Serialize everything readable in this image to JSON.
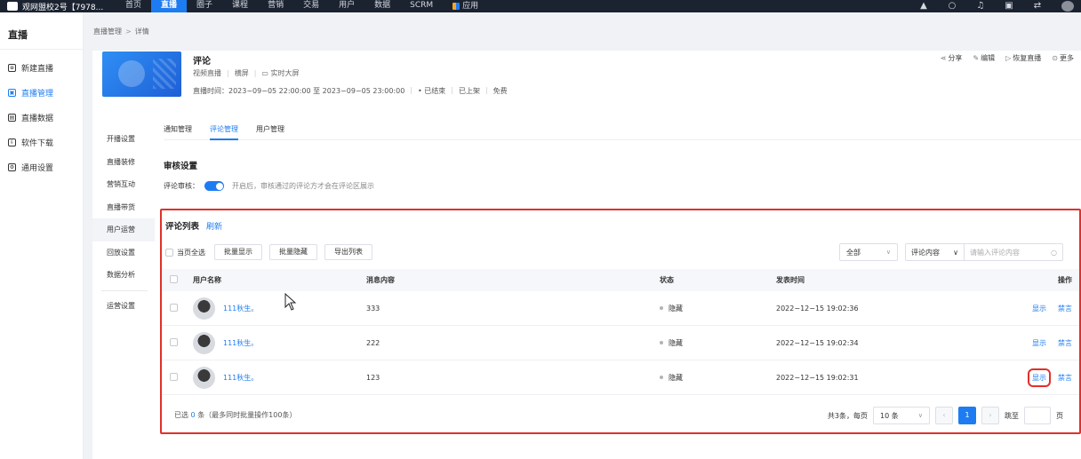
{
  "topnav": {
    "brand": "观网盟校2号【7978...",
    "items": [
      "首页",
      "直播",
      "圈子",
      "课程",
      "营销",
      "交易",
      "用户",
      "数据",
      "SCRM",
      "应用"
    ],
    "active_index": 1,
    "accent_color": "#1e7cf2",
    "icons": [
      "logo-icon",
      "search-icon",
      "bell-icon",
      "layout-icon",
      "swap-icon",
      "avatar"
    ]
  },
  "sidebar": {
    "title": "直播",
    "items": [
      {
        "label": "新建直播",
        "icon": "new-live-icon"
      },
      {
        "label": "直播管理",
        "icon": "live-manage-icon",
        "active": true
      },
      {
        "label": "直播数据",
        "icon": "live-data-icon"
      },
      {
        "label": "软件下载",
        "icon": "download-icon"
      },
      {
        "label": "通用设置",
        "icon": "settings-icon"
      }
    ]
  },
  "breadcrumb": {
    "parent": "直播管理",
    "sep": ">",
    "current": "详情"
  },
  "live_info": {
    "title": "评论",
    "type": "视频直播",
    "orientation": "横屏",
    "screen": "实时大屏",
    "time_label": "直播时间：2023−09−05 22:00:00 至 2023−09−05 23:00:00",
    "status": "• 已结束",
    "shelf": "已上架",
    "price": "免费",
    "actions": [
      {
        "label": "分享",
        "icon": "share-icon"
      },
      {
        "label": "编辑",
        "icon": "edit-icon"
      },
      {
        "label": "恢复直播",
        "icon": "restore-live-icon"
      },
      {
        "label": "更多",
        "icon": "more-icon"
      }
    ]
  },
  "subnav": {
    "items": [
      "开播设置",
      "直播装修",
      "营销互动",
      "直播带货",
      "用户运营",
      "回放设置",
      "数据分析"
    ],
    "active_index": 4,
    "bottom": "运营设置"
  },
  "tabs": {
    "items": [
      "通知管理",
      "评论管理",
      "用户管理"
    ],
    "active_index": 1
  },
  "audit": {
    "title": "审核设置",
    "label": "评论审核：",
    "enabled": true,
    "hint": "开启后，审核通过的评论方才会在评论区展示"
  },
  "comment_list": {
    "title": "评论列表",
    "refresh": "刷新",
    "select_all": "当页全选",
    "buttons": [
      "批量显示",
      "批量隐藏",
      "导出列表"
    ],
    "filter_scope": "全部",
    "filter_field": "评论内容",
    "search_placeholder": "请输入评论内容",
    "columns": [
      "用户名称",
      "消息内容",
      "状态",
      "发表时间",
      "操作"
    ],
    "rows": [
      {
        "user": "111秋生。",
        "message": "333",
        "status": "隐藏",
        "time": "2022−12−15 19:02:36",
        "op_show": "显示",
        "op_ban": "禁言"
      },
      {
        "user": "111秋生。",
        "message": "222",
        "status": "隐藏",
        "time": "2022−12−15 19:02:34",
        "op_show": "显示",
        "op_ban": "禁言"
      },
      {
        "user": "111秋生。",
        "message": "123",
        "status": "隐藏",
        "time": "2022−12−15 19:02:31",
        "op_show": "显示",
        "op_ban": "禁言"
      }
    ],
    "footer_prefix": "已选",
    "footer_count": "0",
    "footer_suffix": "条（最多同时批量操作100条）",
    "total_label": "共3条，每页",
    "page_size": "10 条",
    "current_page": "1",
    "jump_label": "跳至",
    "page_unit": "页"
  }
}
